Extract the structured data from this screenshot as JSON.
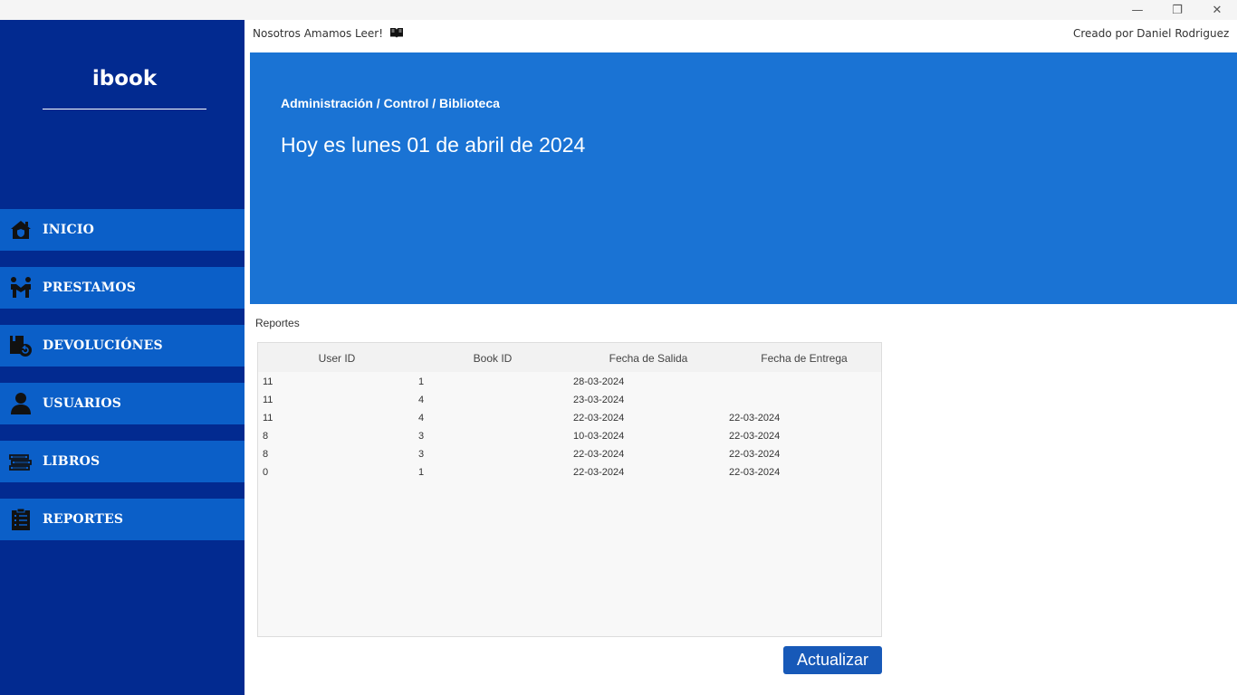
{
  "window": {
    "minimize": "—",
    "restore": "❐",
    "close": "✕"
  },
  "sidebar": {
    "logo": "ibook",
    "items": [
      {
        "label": "INICIO",
        "icon": "home-icon"
      },
      {
        "label": "PRESTAMOS",
        "icon": "handshake-icon"
      },
      {
        "label": "DEVOLUCIÓNES",
        "icon": "return-icon"
      },
      {
        "label": "USUARIOS",
        "icon": "user-icon"
      },
      {
        "label": "LIBROS",
        "icon": "books-icon"
      },
      {
        "label": "REPORTES",
        "icon": "clipboard-icon"
      }
    ]
  },
  "topbar": {
    "slogan": "Nosotros Amamos Leer!",
    "author": "Creado por Daniel Rodriguez"
  },
  "banner": {
    "breadcrumb": "Administración / Control / Biblioteca",
    "date": "Hoy es lunes 01 de abril de 2024"
  },
  "reports": {
    "title": "Reportes",
    "columns": [
      "User ID",
      "Book ID",
      "Fecha de Salida",
      "Fecha de Entrega"
    ],
    "rows": [
      [
        "11",
        "1",
        "28-03-2024",
        ""
      ],
      [
        "11",
        "4",
        "23-03-2024",
        ""
      ],
      [
        "11",
        "4",
        "22-03-2024",
        "22-03-2024"
      ],
      [
        "8",
        "3",
        "10-03-2024",
        "22-03-2024"
      ],
      [
        "8",
        "3",
        "22-03-2024",
        "22-03-2024"
      ],
      [
        "0",
        "1",
        "22-03-2024",
        "22-03-2024"
      ]
    ],
    "refresh_label": "Actualizar"
  },
  "colors": {
    "sidebar": "#022a90",
    "nav_item": "#0b5fc8",
    "banner": "#1a73d4",
    "button": "#1759b8"
  }
}
